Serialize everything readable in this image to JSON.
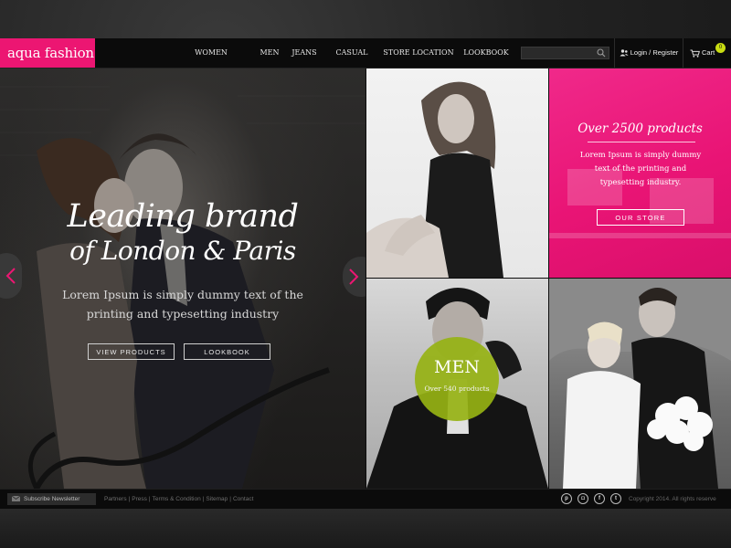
{
  "header": {
    "logo": "aqua fashion",
    "nav": [
      "WOMEN",
      "MEN",
      "JEANS",
      "CASUAL",
      "STORE LOCATION",
      "LOOKBOOK"
    ],
    "search_placeholder": "",
    "login_label": "Login / Register",
    "cart_label": "Cart",
    "cart_count": "0"
  },
  "hero": {
    "title_line1": "Leading brand",
    "title_line2": "of London & Paris",
    "text": "Lorem Ipsum is simply dummy text of the printing and typesetting industry",
    "button_products": "VIEW PRODUCTS",
    "button_lookbook": "LOOKBOOK"
  },
  "promo": {
    "title": "Over 2500 products",
    "text": "Lorem Ipsum is simply dummy text of the printing and typesetting industry.",
    "button": "OUR STORE"
  },
  "men_tile": {
    "title": "MEN",
    "subtitle": "Over 540 products"
  },
  "footer": {
    "subscribe": "Subscribe Newsletter",
    "links": [
      "Partners",
      "Press",
      "Terms & Condition",
      "Sitemap",
      "Contact"
    ],
    "social": [
      "pinterest-icon",
      "instagram-icon",
      "facebook-icon",
      "twitter-icon"
    ],
    "copyright": "Copyright 2014. All rights reserve"
  },
  "colors": {
    "brand_pink": "#ec1672",
    "men_green": "#96b214",
    "cart_badge": "#c8dc12",
    "header_bg": "#0b0b0b"
  }
}
